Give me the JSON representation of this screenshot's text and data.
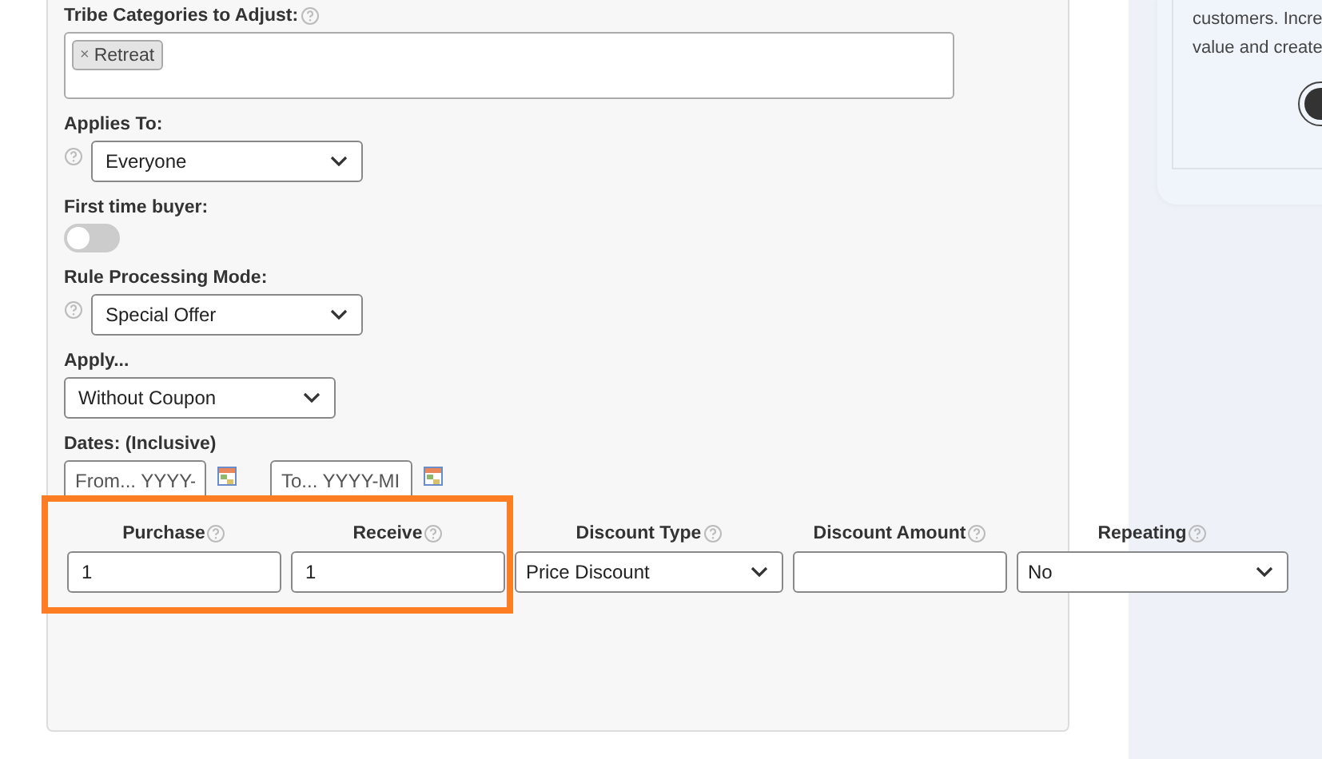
{
  "form": {
    "fields": [
      {
        "kind": "tags",
        "label": "Tribe Categories to Adjust:",
        "help": true,
        "tags": [
          "Retreat"
        ],
        "tag_remove": "×"
      },
      {
        "kind": "select",
        "label": "Applies To:",
        "help": true,
        "value": "Everyone"
      },
      {
        "kind": "toggle",
        "label": "First time buyer:",
        "on": false
      },
      {
        "kind": "select",
        "label": "Rule Processing Mode:",
        "help": true,
        "value": "Special Offer"
      },
      {
        "kind": "select",
        "label": "Apply...",
        "help": false,
        "value": "Without Coupon"
      },
      {
        "kind": "dates",
        "label": "Dates: (Inclusive)",
        "from_placeholder": "From... YYYY-",
        "to_placeholder": "To... YYYY-MI"
      }
    ],
    "columns": [
      {
        "kind": "input",
        "label": "Purchase",
        "value": "1",
        "highlighted": true
      },
      {
        "kind": "input",
        "label": "Receive",
        "value": "1",
        "highlighted": true
      },
      {
        "kind": "select",
        "label": "Discount Type",
        "value": "Price Discount",
        "highlighted": false
      },
      {
        "kind": "input",
        "label": "Discount Amount",
        "highlighted": false
      },
      {
        "kind": "select",
        "label": "Repeating",
        "value": "No",
        "highlighted": false
      }
    ]
  },
  "side_card": {
    "lines": [
      "customers. Incre",
      "value and create"
    ]
  }
}
